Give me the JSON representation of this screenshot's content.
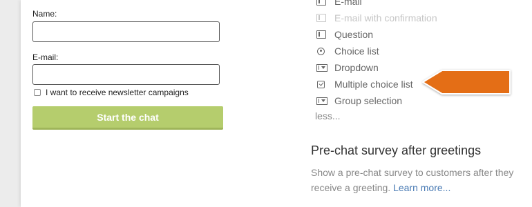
{
  "form": {
    "name_label": "Name:",
    "name_value": "",
    "email_label": "E-mail:",
    "email_value": "",
    "newsletter_label": "I want to receive newsletter campaigns",
    "newsletter_checked": false,
    "start_button": "Start the chat"
  },
  "field_types": {
    "items": [
      {
        "label": "E-mail",
        "icon": "text-input-icon",
        "state": "normal"
      },
      {
        "label": "E-mail with confirmation",
        "icon": "text-input-icon",
        "state": "disabled"
      },
      {
        "label": "Question",
        "icon": "text-input-icon",
        "state": "normal"
      },
      {
        "label": "Choice list",
        "icon": "radio-icon",
        "state": "normal"
      },
      {
        "label": "Dropdown",
        "icon": "dropdown-icon",
        "state": "normal"
      },
      {
        "label": "Multiple choice list",
        "icon": "checkbox-icon",
        "state": "normal"
      },
      {
        "label": "Group selection",
        "icon": "dropdown-icon",
        "state": "normal"
      }
    ],
    "less_label": "less..."
  },
  "survey_section": {
    "title": "Pre-chat survey after greetings",
    "description": "Show a pre-chat survey to customers after they receive a greeting.",
    "learn_more": "Learn more..."
  },
  "colors": {
    "start_button": "#b5cd6d",
    "callout_arrow": "#e46e14",
    "link": "#4a7bb4"
  }
}
